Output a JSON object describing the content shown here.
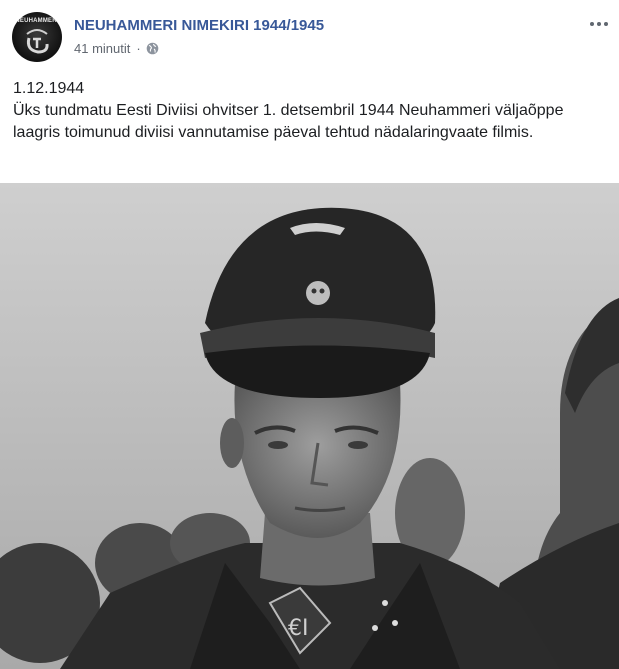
{
  "post": {
    "page_name": "NEUHAMMERI NIMEKIRI 1944/1945",
    "avatar_text": "NEUHAMMERI",
    "time_ago": "41 minutit",
    "separator": "·",
    "audience_icon": "globe-icon",
    "more_icon": "more-options-icon",
    "text_lines": [
      "1.12.1944",
      "Üks tundmatu Eesti Diviisi ohvitser 1. detsembril 1944 Neuhammeri väljaõppe laagris toimunud diviisi vannutamise päeval tehtud nädalaringvaate filmis."
    ],
    "image_description_icon": "photo",
    "colors": {
      "link": "#385898",
      "meta": "#616770",
      "text": "#1c1e21"
    }
  }
}
